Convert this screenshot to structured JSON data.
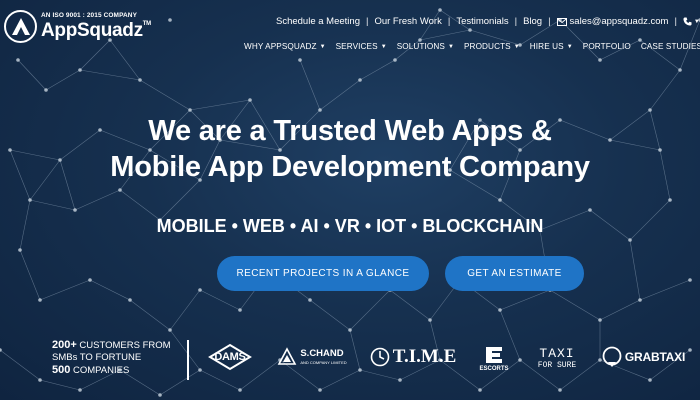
{
  "brand": {
    "iso_text": "AN ISO 9001 : 2015 COMPANY",
    "name": "AppSquadz",
    "tm": "TM"
  },
  "top_links": [
    {
      "label": "Schedule a Meeting"
    },
    {
      "label": "Our Fresh Work"
    },
    {
      "label": "Testimonials"
    },
    {
      "label": "Blog"
    }
  ],
  "contact": {
    "email": "sales@appsquadz.com",
    "icon": "mail-icon",
    "phone_icon": "phone-icon"
  },
  "nav": [
    {
      "label": "WHY APPSQUADZ",
      "dropdown": true
    },
    {
      "label": "SERVICES",
      "dropdown": true
    },
    {
      "label": "SOLUTIONS",
      "dropdown": true
    },
    {
      "label": "PRODUCTS",
      "dropdown": true
    },
    {
      "label": "HIRE US",
      "dropdown": true
    },
    {
      "label": "PORTFOLIO",
      "dropdown": false
    },
    {
      "label": "CASE STUDIES",
      "dropdown": false
    }
  ],
  "hero": {
    "line1": "We are a Trusted Web Apps &",
    "line2": "Mobile App Development Company",
    "tags": "MOBILE • WEB • AI • VR • IOT • BLOCKCHAIN"
  },
  "buttons": {
    "projects": "RECENT PROJECTS IN A GLANCE",
    "estimate": "GET AN ESTIMATE"
  },
  "customers": {
    "line1_strong": "200+",
    "line1_rest": " CUSTOMERS FROM",
    "line2": "SMBs TO FORTUNE",
    "line3_strong": "500",
    "line3_rest": " COMPANIES"
  },
  "clients": [
    {
      "name": "DAMS"
    },
    {
      "name": "S.CHAND",
      "sub": "AND COMPANY LIMITED"
    },
    {
      "name": "T.I.M.E"
    },
    {
      "name": "ESCORTS"
    },
    {
      "name": "TAXI",
      "sub": "FOR SURE"
    },
    {
      "name": "GRABTAXI"
    }
  ],
  "colors": {
    "background": "#16304f",
    "button": "#1f74c6",
    "text": "#ffffff"
  }
}
